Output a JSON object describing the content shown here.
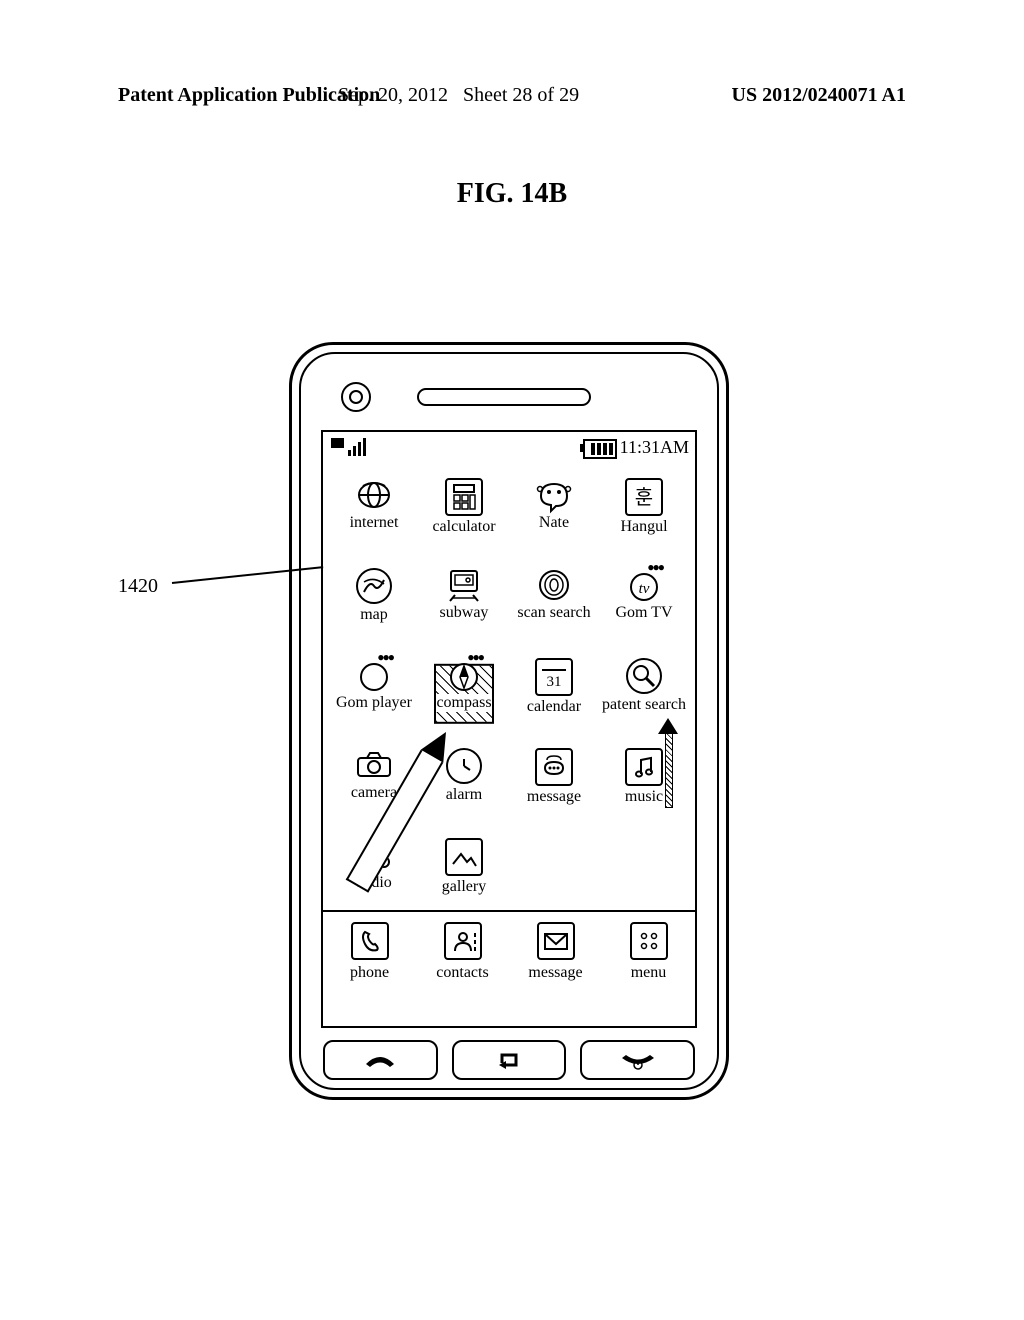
{
  "header": {
    "left": "Patent Application Publication",
    "mid_date": "Sep. 20, 2012",
    "mid_sheet": "Sheet 28 of 29",
    "right": "US 2012/0240071 A1"
  },
  "figure_title": "FIG. 14B",
  "reference_numeral": "1420",
  "statusbar": {
    "time": "11:31AM"
  },
  "apps": {
    "row1": [
      {
        "label": "internet"
      },
      {
        "label": "calculator"
      },
      {
        "label": "Nate"
      },
      {
        "label": "Hangul"
      }
    ],
    "row2": [
      {
        "label": "map"
      },
      {
        "label": "subway"
      },
      {
        "label": "scan search"
      },
      {
        "label": "Gom TV"
      }
    ],
    "row3": [
      {
        "label": "Gom player"
      },
      {
        "label": "compass"
      },
      {
        "label": "calendar",
        "badge": "31"
      },
      {
        "label": "patent search"
      }
    ],
    "row4": [
      {
        "label": "camera"
      },
      {
        "label": "alarm"
      },
      {
        "label": "message"
      },
      {
        "label": "music"
      }
    ],
    "row5": [
      {
        "label": "audio"
      },
      {
        "label": "gallery"
      }
    ]
  },
  "dock": [
    {
      "label": "phone"
    },
    {
      "label": "contacts"
    },
    {
      "label": "message"
    },
    {
      "label": "menu"
    }
  ]
}
